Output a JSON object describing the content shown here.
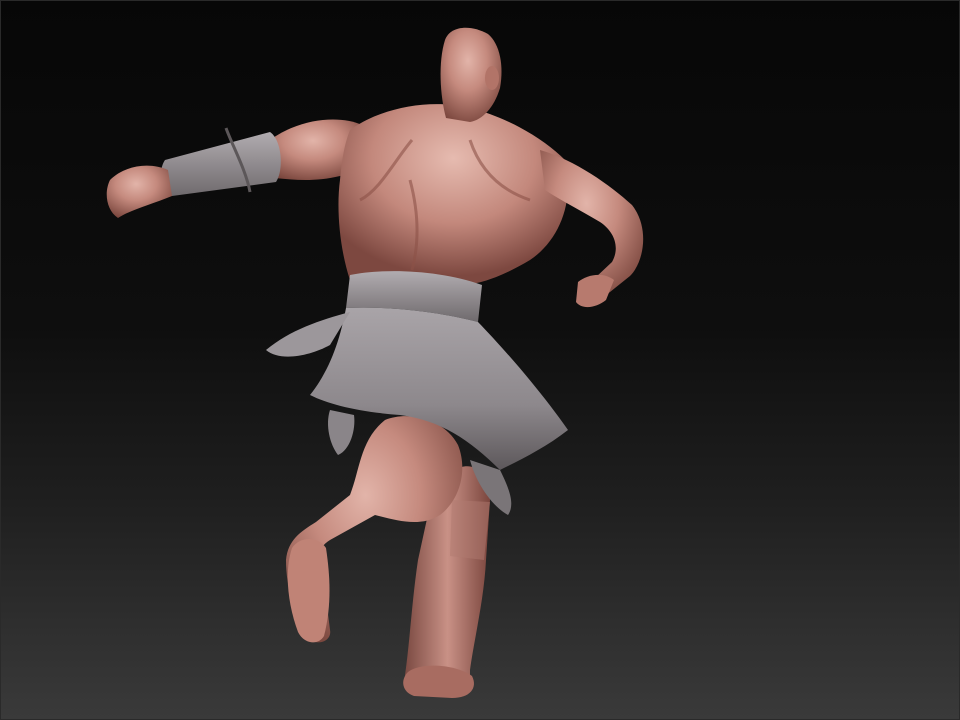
{
  "scene": {
    "subject": "sculpted-figure",
    "colors": {
      "background_top": "#070707",
      "background_bottom": "#3a3a3a",
      "skin_light": "#d9a79c",
      "skin_mid": "#b7796d",
      "skin_dark": "#6e3f37",
      "cloth_light": "#a7a2a6",
      "cloth_mid": "#8a8589",
      "cloth_dark": "#4f4b4e"
    }
  }
}
